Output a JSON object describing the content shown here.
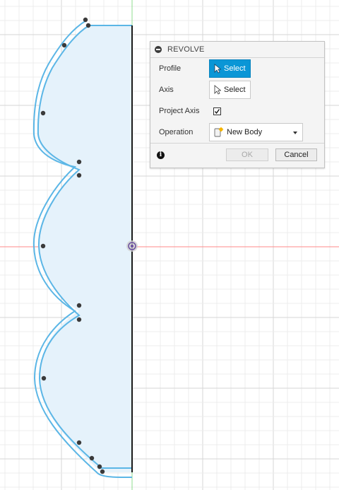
{
  "dialog": {
    "title": "REVOLVE",
    "profile": {
      "label": "Profile",
      "button": "Select",
      "active": true
    },
    "axis": {
      "label": "Axis",
      "button": "Select",
      "active": false
    },
    "project_axis": {
      "label": "Project Axis",
      "checked": true
    },
    "operation": {
      "label": "Operation",
      "value": "New Body"
    },
    "ok_label": "OK",
    "ok_enabled": false,
    "cancel_label": "Cancel",
    "info_glyph": "i"
  },
  "icons": [
    "collapse-icon",
    "cursor-arrow-icon",
    "new-body-icon",
    "chevron-down-icon",
    "info-icon",
    "checkmark-icon"
  ],
  "colors": {
    "accent": "#0a96d6",
    "profile_line": "#5bb6e6",
    "profile_fill": "#e5f2fb",
    "x_axis": "#ff8080",
    "y_axis": "#7fd67f",
    "axis_line": "#1a1a1a",
    "grid_minor": "#ececec",
    "grid_major": "#d6d6d6"
  }
}
